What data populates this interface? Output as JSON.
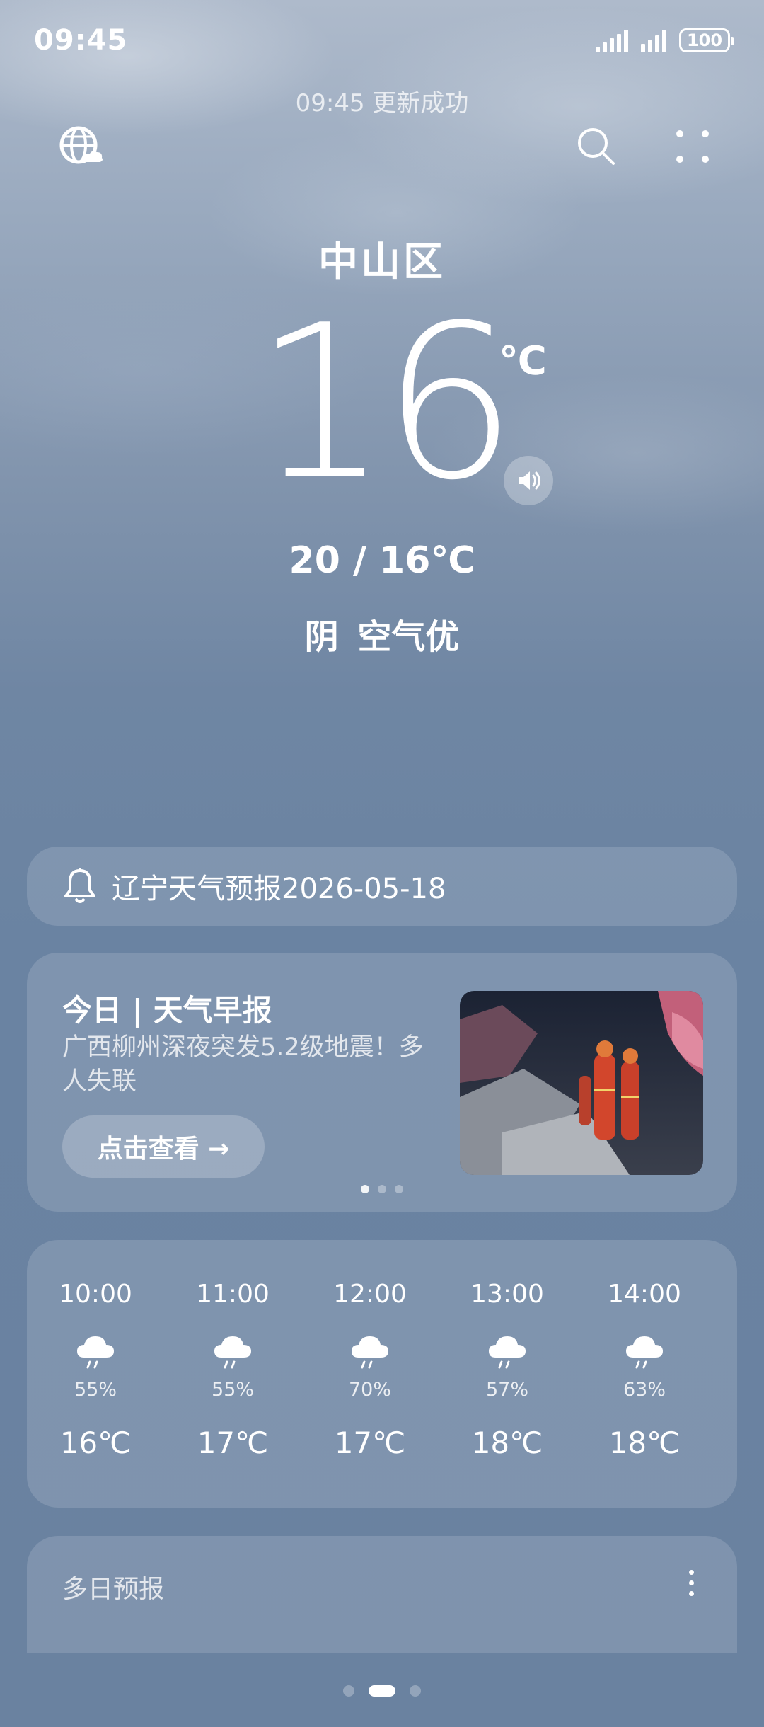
{
  "status_bar": {
    "time": "09:45",
    "battery": "100",
    "icons": [
      "signal-icon",
      "signal-icon",
      "battery-icon"
    ]
  },
  "update_status": "09:45 更新成功",
  "header": {
    "left_icon": "globe-weather-icon",
    "right_icons": [
      "search-icon",
      "more-grid-icon"
    ]
  },
  "current": {
    "city": "中山区",
    "temperature": "16",
    "unit": "℃",
    "range": "20 / 16℃",
    "condition": "阴 空气优",
    "speaker_icon": "speaker-icon"
  },
  "alert": {
    "icon": "bell-icon",
    "text": "辽宁天气预报2026-05-18"
  },
  "news": {
    "title": "今日 | 天气早报",
    "description": "广西柳州深夜突发5.2级地震！多人失联",
    "button_label": "点击查看 →",
    "page_dots": 3,
    "active_dot": 0
  },
  "hourly": [
    {
      "time": "10:00",
      "icon": "cloud-rain-icon",
      "pop": "55%",
      "temp": "16℃"
    },
    {
      "time": "11:00",
      "icon": "cloud-rain-icon",
      "pop": "55%",
      "temp": "17℃"
    },
    {
      "time": "12:00",
      "icon": "cloud-rain-icon",
      "pop": "70%",
      "temp": "17℃"
    },
    {
      "time": "13:00",
      "icon": "cloud-rain-icon",
      "pop": "57%",
      "temp": "18℃"
    },
    {
      "time": "14:00",
      "icon": "cloud-rain-icon",
      "pop": "63%",
      "temp": "18℃"
    }
  ],
  "daily": {
    "title": "多日预报",
    "more_icon": "more-vertical-icon"
  },
  "page_indicator": {
    "count": 3,
    "active": 1
  }
}
